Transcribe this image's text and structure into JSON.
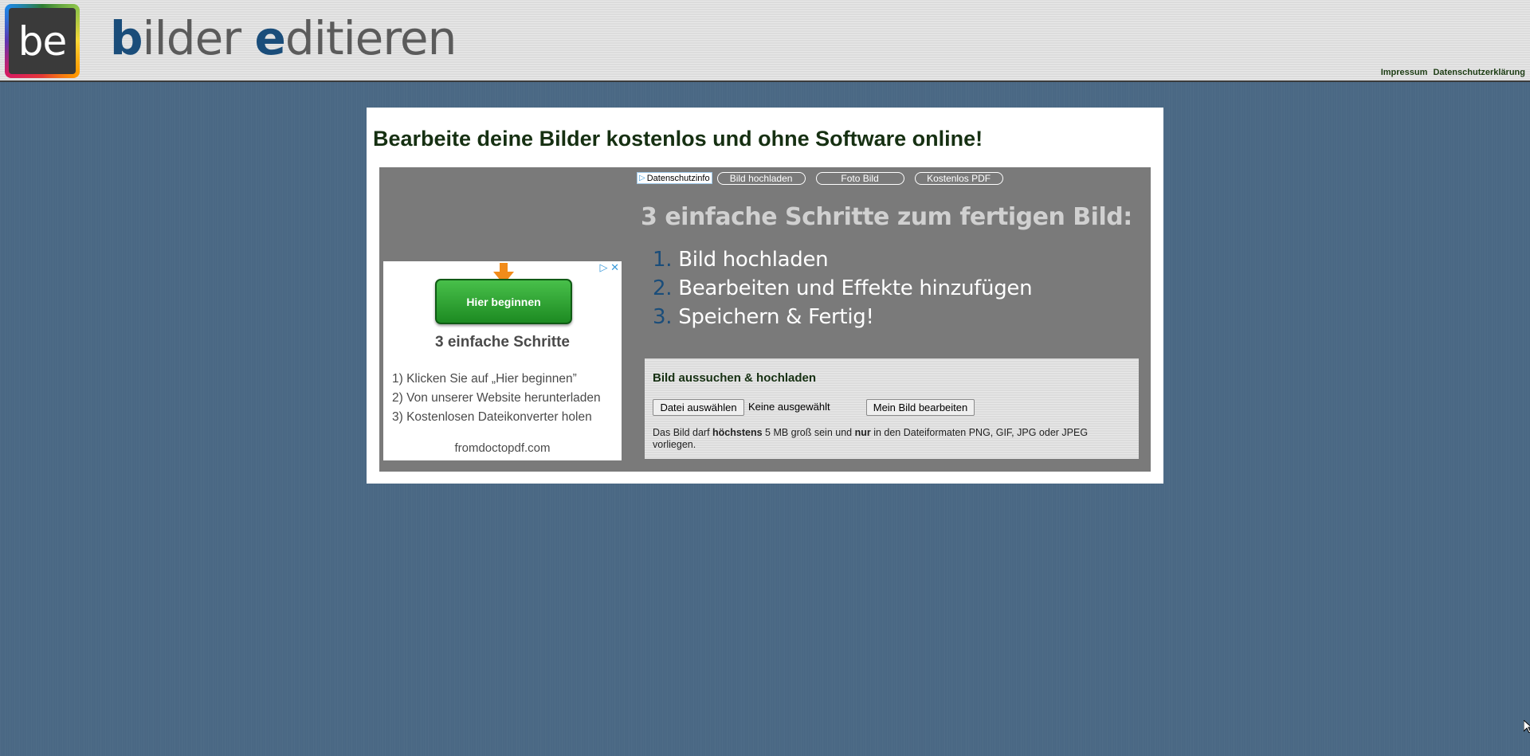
{
  "header": {
    "logo_text": "be",
    "title_part1_hl": "b",
    "title_part1_rest": "ilder ",
    "title_part2_hl": "e",
    "title_part2_rest": "ditieren",
    "links": [
      "Impressum",
      "Datenschutzerklärung"
    ]
  },
  "main": {
    "heading": "Bearbeite deine Bilder kostenlos und ohne Software online!",
    "adlinks": {
      "info": "Datenschutzinfo",
      "pills": [
        "Bild hochladen",
        "Foto Bild",
        "Kostenlos PDF"
      ]
    },
    "ad": {
      "button": "Hier beginnen",
      "heading": "3 einfache Schritte",
      "steps": [
        "1) Klicken Sie auf „Hier beginnen”",
        "2) Von unserer Website herunterladen",
        "3) Kostenlosen Dateikonverter holen"
      ],
      "domain": "fromdoctopdf.com"
    },
    "steps_title": "3 einfache Schritte zum fertigen Bild:",
    "steps": [
      {
        "num": "1.",
        "text": "Bild hochladen"
      },
      {
        "num": "2.",
        "text": "Bearbeiten und Effekte hinzufügen"
      },
      {
        "num": "3.",
        "text": "Speichern & Fertig!"
      }
    ],
    "upload": {
      "title": "Bild aussuchen & hochladen",
      "choose_button": "Datei auswählen",
      "file_status": "Keine ausgewählt",
      "submit_button": "Mein Bild bearbeiten",
      "note_1": "Das Bild darf ",
      "note_b1": "höchstens",
      "note_2": " 5 MB groß sein und ",
      "note_b2": "nur",
      "note_3": " in den Dateiformaten PNG, GIF, JPG oder JPEG vorliegen."
    }
  },
  "colors": {
    "background": "#4a6884",
    "accent_blue": "#1a4d7a",
    "heading_green": "#163012",
    "ad_green": "#2aa030"
  }
}
